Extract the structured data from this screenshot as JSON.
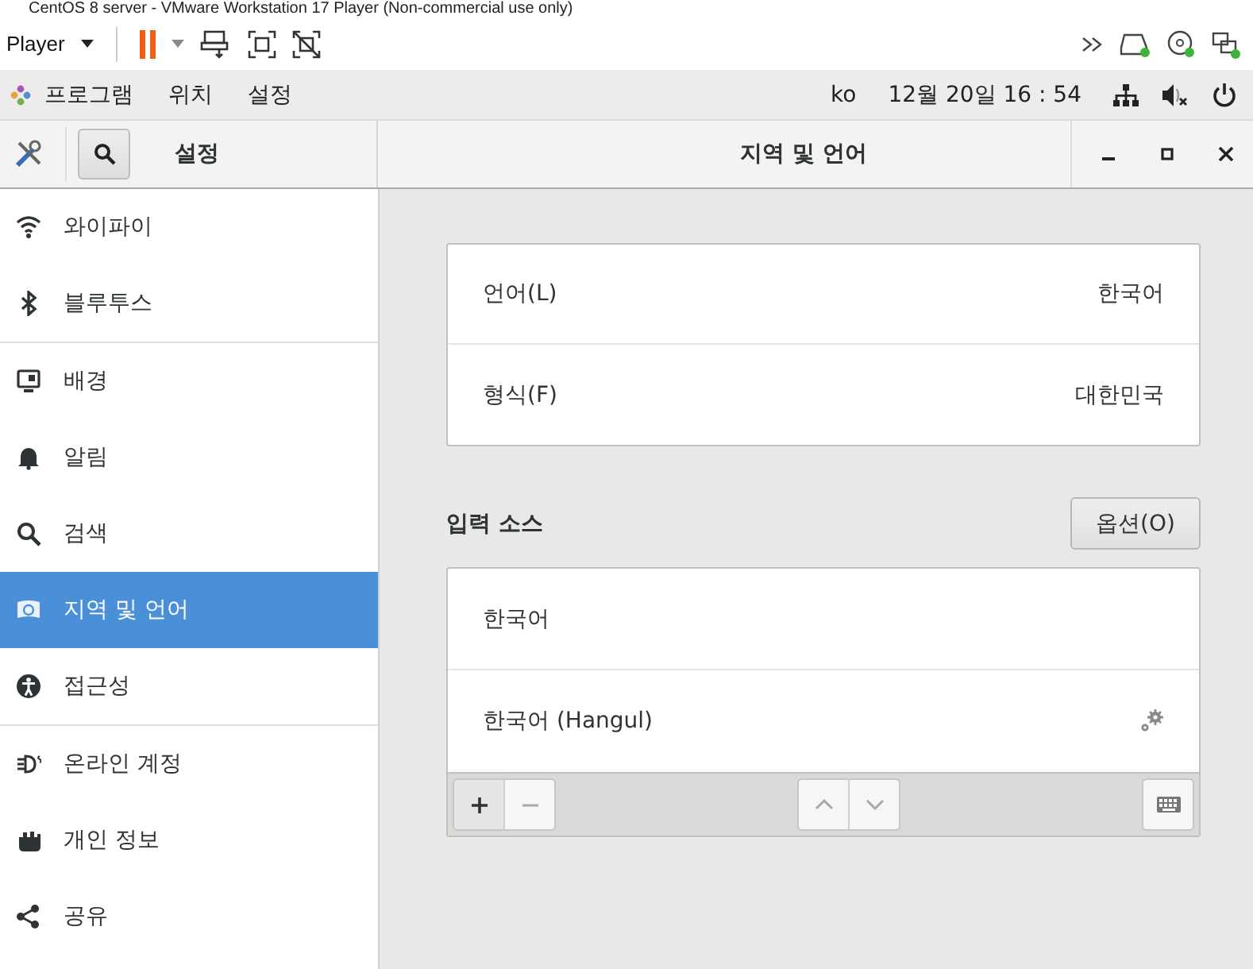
{
  "window": {
    "title": "CentOS 8 server - VMware Workstation 17 Player (Non-commercial use only)"
  },
  "player_toolbar": {
    "menu": "Player"
  },
  "top_bar": {
    "menus": [
      "프로그램",
      "위치",
      "설정"
    ],
    "input_method": "ko",
    "clock": "12월 20일  16 : 54"
  },
  "settings": {
    "header_title": "설정",
    "page_title": "지역 및 언어",
    "sidebar": {
      "groups": [
        {
          "items": [
            {
              "label": "와이파이",
              "kind": "wifi",
              "selected": false
            },
            {
              "label": "블루투스",
              "kind": "bluetooth",
              "selected": false
            }
          ]
        },
        {
          "items": [
            {
              "label": "배경",
              "kind": "background",
              "selected": false
            },
            {
              "label": "알림",
              "kind": "bell",
              "selected": false
            },
            {
              "label": "검색",
              "kind": "search",
              "selected": false
            },
            {
              "label": "지역 및 언어",
              "kind": "flag",
              "selected": true
            },
            {
              "label": "접근성",
              "kind": "accessibility",
              "selected": false
            }
          ]
        },
        {
          "items": [
            {
              "label": "온라인 계정",
              "kind": "accounts",
              "selected": false
            },
            {
              "label": "개인 정보",
              "kind": "hand",
              "selected": false
            },
            {
              "label": "공유",
              "kind": "share",
              "selected": false
            }
          ]
        }
      ]
    },
    "language_rows": [
      {
        "label": "언어(L)",
        "value": "한국어"
      },
      {
        "label": "형식(F)",
        "value": "대한민국"
      }
    ],
    "input_sources": {
      "title": "입력 소스",
      "options_button": "옵션(O)",
      "items": [
        {
          "label": "한국어",
          "has_settings": false
        },
        {
          "label": "한국어 (Hangul)",
          "has_settings": true
        }
      ],
      "toolbar": [
        {
          "kind": "add",
          "disabled": false
        },
        {
          "kind": "remove",
          "disabled": true
        },
        {
          "kind": "up",
          "disabled": true
        },
        {
          "kind": "down",
          "disabled": true
        },
        {
          "kind": "keyboard",
          "disabled": false
        }
      ]
    }
  }
}
